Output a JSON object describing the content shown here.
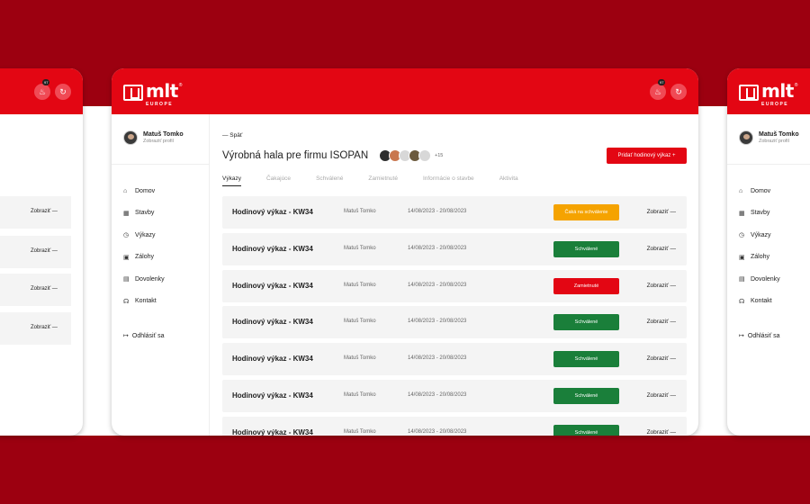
{
  "brand": {
    "name": "mlt",
    "sub": "EUROPE",
    "reg": "®"
  },
  "notifications": {
    "count": "97"
  },
  "user": {
    "name": "Matuš Tomko",
    "profile_link": "Zobraziť profil"
  },
  "nav": [
    {
      "label": "Domov",
      "icon": "home-icon"
    },
    {
      "label": "Stavby",
      "icon": "building-icon"
    },
    {
      "label": "Výkazy",
      "icon": "clock-icon"
    },
    {
      "label": "Zálohy",
      "icon": "money-icon"
    },
    {
      "label": "Dovolenky",
      "icon": "suitcase-icon"
    },
    {
      "label": "Kontakt",
      "icon": "headset-icon"
    }
  ],
  "logout": "Odhlásiť sa",
  "page": {
    "back": "— Späť",
    "title": "Výrobná hala pre firmu ISOPAN",
    "members_more": "+15",
    "add_button": "Pridať hodinový výkaz  +"
  },
  "tabs": [
    "Výkazy",
    "Čakajúce",
    "Schválené",
    "Zamietnuté",
    "Informácie o stavbe",
    "Aktivita"
  ],
  "status_colors": {
    "pending": "#f5a300",
    "approved": "#1a7f3a",
    "rejected": "#e30613"
  },
  "rows": [
    {
      "title": "Hodinový výkaz - KW34",
      "name": "Matuš Tomko",
      "dates": "14/08/2023 - 20/08/2023",
      "status": "Čaká na schválenie",
      "type": "pending",
      "action": "Zobraziť —"
    },
    {
      "title": "Hodinový výkaz - KW34",
      "name": "Matuš Tomko",
      "dates": "14/08/2023 - 20/08/2023",
      "status": "Schválené",
      "type": "approved",
      "action": "Zobraziť —"
    },
    {
      "title": "Hodinový výkaz - KW34",
      "name": "Matuš Tomko",
      "dates": "14/08/2023 - 20/08/2023",
      "status": "Zamietnuté",
      "type": "rejected",
      "action": "Zobraziť —"
    },
    {
      "title": "Hodinový výkaz - KW34",
      "name": "Matuš Tomko",
      "dates": "14/08/2023 - 20/08/2023",
      "status": "Schválené",
      "type": "approved",
      "action": "Zobraziť —"
    },
    {
      "title": "Hodinový výkaz - KW34",
      "name": "Matuš Tomko",
      "dates": "14/08/2023 - 20/08/2023",
      "status": "Schválené",
      "type": "approved",
      "action": "Zobraziť —"
    },
    {
      "title": "Hodinový výkaz - KW34",
      "name": "Matuš Tomko",
      "dates": "14/08/2023 - 20/08/2023",
      "status": "Schválené",
      "type": "approved",
      "action": "Zobraziť —"
    },
    {
      "title": "Hodinový výkaz - KW34",
      "name": "Matuš Tomko",
      "dates": "14/08/2023 - 20/08/2023",
      "status": "Schválené",
      "type": "approved",
      "action": "Zobraziť —"
    }
  ],
  "peek_action": "Zobraziť —"
}
